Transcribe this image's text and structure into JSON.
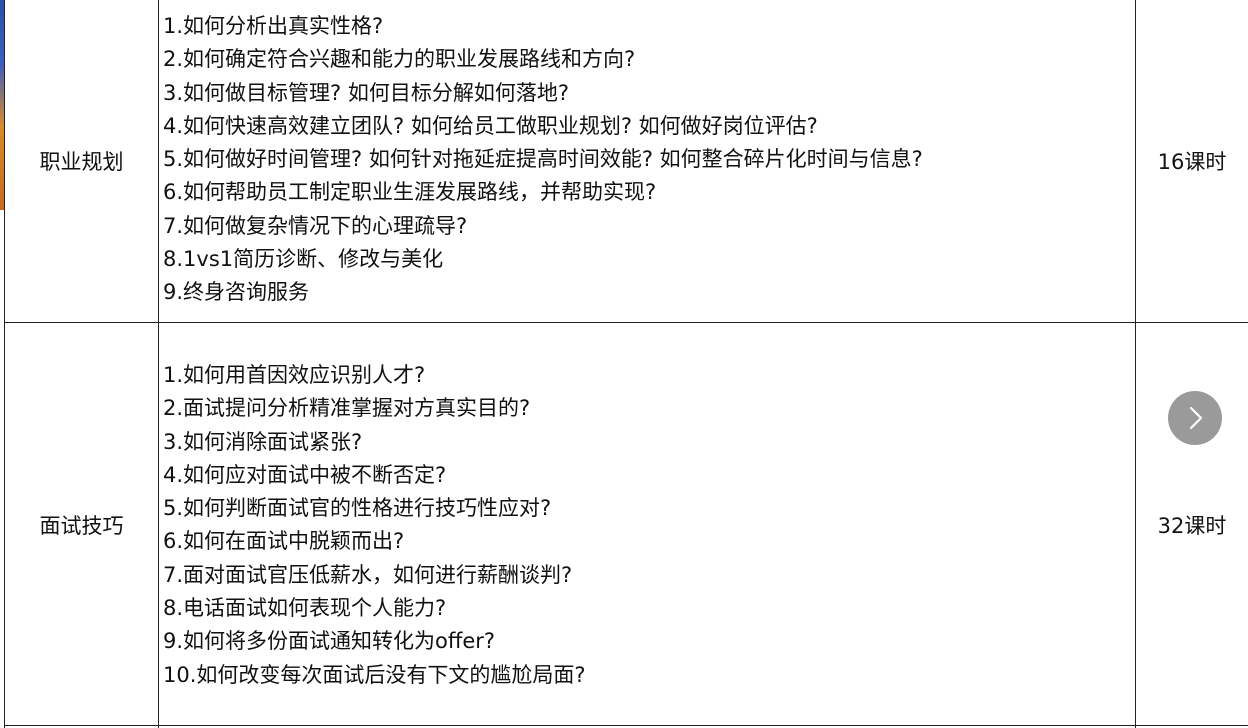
{
  "table": {
    "rows": [
      {
        "category": "职业规划",
        "hours": "16课时",
        "items": [
          "1.如何分析出真实性格?",
          "2.如何确定符合兴趣和能力的职业发展路线和方向?",
          "3.如何做目标管理? 如何目标分解如何落地?",
          "4.如何快速高效建立团队? 如何给员工做职业规划? 如何做好岗位评估?",
          "5.如何做好时间管理? 如何针对拖延症提高时间效能? 如何整合碎片化时间与信息?",
          "6.如何帮助员工制定职业生涯发展路线，并帮助实现?",
          "7.如何做复杂情况下的心理疏导?",
          "8.1vs1简历诊断、修改与美化",
          "9.终身咨询服务"
        ]
      },
      {
        "category": "面试技巧",
        "hours": "32课时",
        "items": [
          "1.如何用首因效应识别人才?",
          "2.面试提问分析精准掌握对方真实目的?",
          "3.如何消除面试紧张?",
          "4.如何应对面试中被不断否定?",
          "5.如何判断面试官的性格进行技巧性应对?",
          "6.如何在面试中脱颖而出?",
          "7.面对面试官压低薪水，如何进行薪酬谈判?",
          "8.电话面试如何表现个人能力?",
          "9.如何将多份面试通知转化为offer?",
          "10.如何改变每次面试后没有下文的尴尬局面?"
        ]
      }
    ]
  },
  "controls": {
    "next_icon": "chevron-right-icon",
    "next_button_color": "#9a9a9a"
  }
}
